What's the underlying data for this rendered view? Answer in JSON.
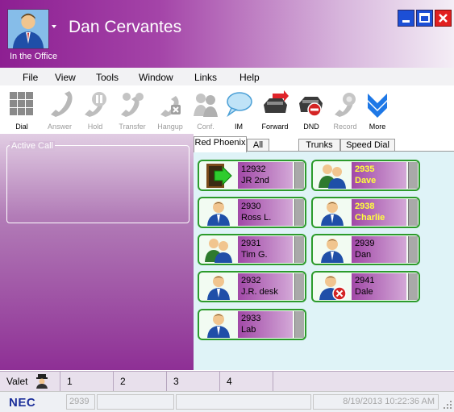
{
  "header": {
    "user_name": "Dan Cervantes",
    "status": "In the Office",
    "avatar_icon": "user-avatar-icon"
  },
  "window_controls": [
    "minimize",
    "maximize",
    "close"
  ],
  "menu": [
    "File",
    "View",
    "Tools",
    "Window",
    "Links",
    "Help"
  ],
  "toolbar": [
    {
      "label": "Dial",
      "icon": "dialpad-icon",
      "enabled": true
    },
    {
      "label": "Answer",
      "icon": "handset-icon",
      "enabled": false
    },
    {
      "label": "Hold",
      "icon": "hold-icon",
      "enabled": false
    },
    {
      "label": "Transfer",
      "icon": "transfer-icon",
      "enabled": false
    },
    {
      "label": "Hangup",
      "icon": "hangup-icon",
      "enabled": false
    },
    {
      "label": "Conf.",
      "icon": "conference-icon",
      "enabled": false
    },
    {
      "label": "IM",
      "icon": "speech-bubble-icon",
      "enabled": true
    },
    {
      "label": "Forward",
      "icon": "forward-icon",
      "enabled": true
    },
    {
      "label": "DND",
      "icon": "dnd-phone-icon",
      "enabled": true
    },
    {
      "label": "Record",
      "icon": "record-icon",
      "enabled": false
    },
    {
      "label": "More",
      "icon": "chevron-double-down-icon",
      "enabled": true
    }
  ],
  "active_call": {
    "label": "Active Call"
  },
  "tabs": [
    "Red Phoenix",
    "All",
    "Trunks",
    "Speed Dial"
  ],
  "active_tab": "Red Phoenix",
  "extensions": [
    {
      "number": "12932",
      "name": "JR 2nd",
      "icon": "door-exit-icon",
      "busy": false
    },
    {
      "number": "2935",
      "name": "Dave",
      "icon": "group-users-icon",
      "busy": true
    },
    {
      "number": "2930",
      "name": "Ross L.",
      "icon": "user-icon",
      "busy": false
    },
    {
      "number": "2938",
      "name": "Charlie",
      "icon": "user-icon",
      "busy": true
    },
    {
      "number": "2931",
      "name": "Tim G.",
      "icon": "group-users-icon",
      "busy": false
    },
    {
      "number": "2939",
      "name": "Dan",
      "icon": "user-icon",
      "busy": false
    },
    {
      "number": "2932",
      "name": "J.R. desk",
      "icon": "user-icon",
      "busy": false
    },
    {
      "number": "2941",
      "name": "Dale",
      "icon": "user-unavailable-icon",
      "busy": false
    },
    {
      "number": "2933",
      "name": "Lab",
      "icon": "user-icon",
      "busy": false
    }
  ],
  "valet": {
    "label": "Valet",
    "icon": "valet-attendant-icon",
    "slots": [
      "1",
      "2",
      "3",
      "4"
    ]
  },
  "status_bar": {
    "logo": "NEC",
    "extension": "2939",
    "datetime": "8/19/2013 10:22:36 AM"
  },
  "colors": {
    "title_purple": "#8d1f92",
    "card_border": "#2c9b2c",
    "busy_text": "#ffff3c",
    "content_bg": "#dff3f7"
  }
}
